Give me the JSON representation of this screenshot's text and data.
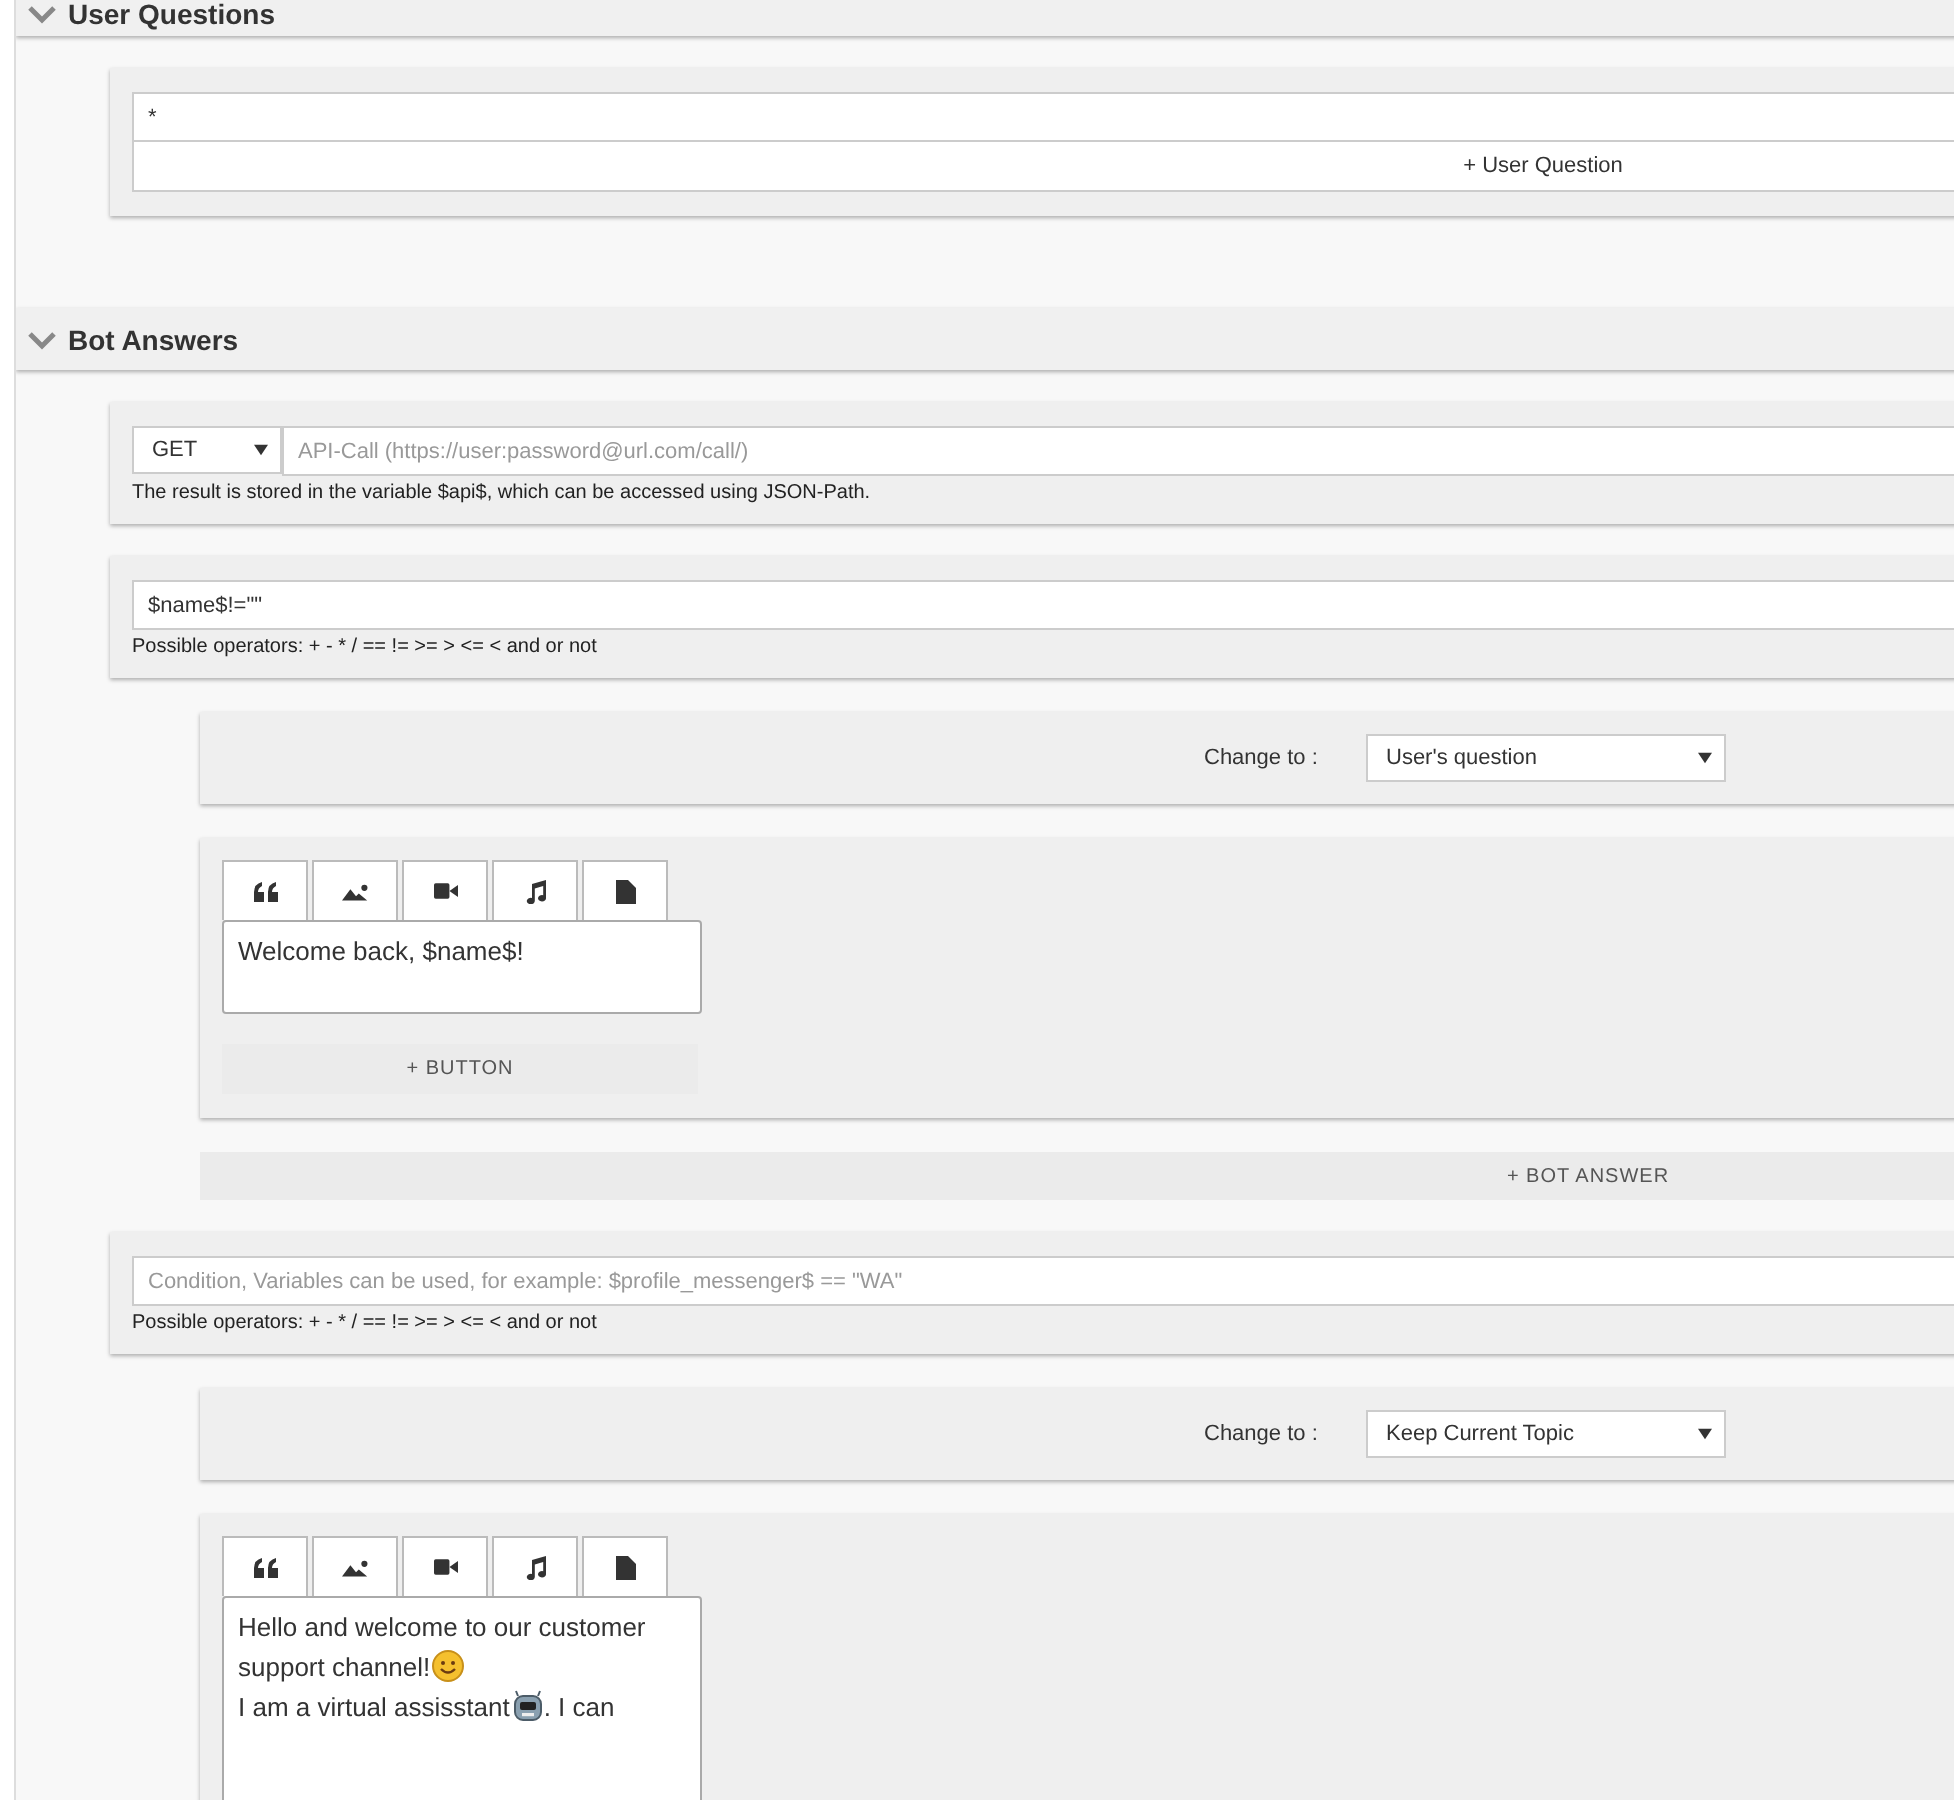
{
  "user_questions": {
    "title": "User Questions",
    "questions": [
      "*"
    ],
    "add_button": "+ User Question"
  },
  "bot_answers": {
    "title": "Bot Answers",
    "api": {
      "method": "GET",
      "placeholder": "API-Call (https://user:password@url.com/call/)",
      "help": "The result is stored in the variable $api$, which can be accessed using JSON-Path."
    },
    "blocks": [
      {
        "condition": {
          "value": "$name$!=\"\"",
          "help": "Possible operators: + - * / == != >= > <= < and or not"
        },
        "change_label": "Change to :",
        "change_value": "User's question",
        "message": [
          [
            {
              "kind": "text",
              "text": "Welcome back, $name$!"
            }
          ]
        ],
        "add_button": "+ BUTTON",
        "add_answer": "+ BOT ANSWER"
      },
      {
        "condition": {
          "placeholder": "Condition, Variables can be used, for example: $profile_messenger$ == \"WA\"",
          "help": "Possible operators: + - * / == != >= > <= < and or not"
        },
        "change_label": "Change to :",
        "change_value": "Keep Current Topic",
        "message": [
          [
            {
              "kind": "text",
              "text": "Hello and welcome to our customer support channel!"
            },
            {
              "kind": "smiley"
            }
          ],
          [
            {
              "kind": "text",
              "text": "I am a virtual assisstant"
            },
            {
              "kind": "robot"
            },
            {
              "kind": "text",
              "text": ". I can"
            }
          ]
        ]
      }
    ]
  }
}
